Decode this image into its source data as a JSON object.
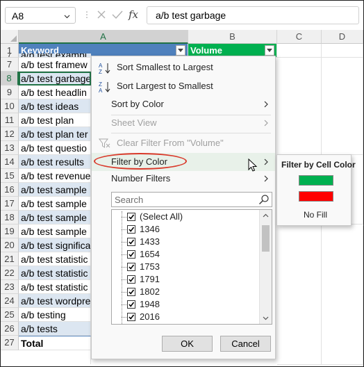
{
  "formula_bar": {
    "name_box": "A8",
    "formula_text": "a/b test garbage",
    "fx_label": "fx"
  },
  "columns": [
    "A",
    "B",
    "C",
    "D"
  ],
  "selected_column": "A",
  "header_row": {
    "row_number": "1",
    "col_a": "Keyword",
    "col_b": "Volume"
  },
  "rows": [
    {
      "num": "7",
      "text": "a/b test exampl"
    },
    {
      "num": "7",
      "text": "a/b test framew"
    },
    {
      "num": "8",
      "text": "a/b test garbage"
    },
    {
      "num": "9",
      "text": "a/b test headlin"
    },
    {
      "num": "10",
      "text": "a/b test ideas"
    },
    {
      "num": "11",
      "text": "a/b test plan"
    },
    {
      "num": "12",
      "text": "a/b test plan ter"
    },
    {
      "num": "13",
      "text": "a/b test questio"
    },
    {
      "num": "14",
      "text": "a/b test results"
    },
    {
      "num": "15",
      "text": "a/b test revenue"
    },
    {
      "num": "16",
      "text": "a/b test sample"
    },
    {
      "num": "17",
      "text": "a/b test sample"
    },
    {
      "num": "18",
      "text": "a/b test sample"
    },
    {
      "num": "19",
      "text": "a/b test sample"
    },
    {
      "num": "20",
      "text": "a/b test significa"
    },
    {
      "num": "21",
      "text": "a/b test statistic"
    },
    {
      "num": "22",
      "text": "a/b test statistic"
    },
    {
      "num": "23",
      "text": "a/b test statistic"
    },
    {
      "num": "24",
      "text": "a/b test wordpre"
    },
    {
      "num": "25",
      "text": "a/b testing"
    },
    {
      "num": "26",
      "text": "a/b tests"
    },
    {
      "num": "27",
      "text": "Total"
    }
  ],
  "menu": {
    "sort_asc": "Sort Smallest to Largest",
    "sort_desc": "Sort Largest to Smallest",
    "sort_by_color": "Sort by Color",
    "sheet_view": "Sheet View",
    "clear_filter": "Clear Filter From \"Volume\"",
    "filter_by_color": "Filter by Color",
    "number_filters": "Number Filters",
    "search_placeholder": "Search",
    "list_items": [
      "(Select All)",
      "1346",
      "1433",
      "1654",
      "1753",
      "1791",
      "1802",
      "1948",
      "2016"
    ],
    "ok": "OK",
    "cancel": "Cancel"
  },
  "submenu": {
    "title": "Filter by Cell Color",
    "swatch_colors": [
      "#00b050",
      "#ff0000"
    ],
    "no_fill": "No Fill"
  },
  "colors": {
    "header_keyword_fill": "#4f81bd",
    "header_volume_fill": "#00b050",
    "band_fill": "#dce6f1",
    "highlight_oval": "#d9392a",
    "excel_green": "#217346"
  }
}
